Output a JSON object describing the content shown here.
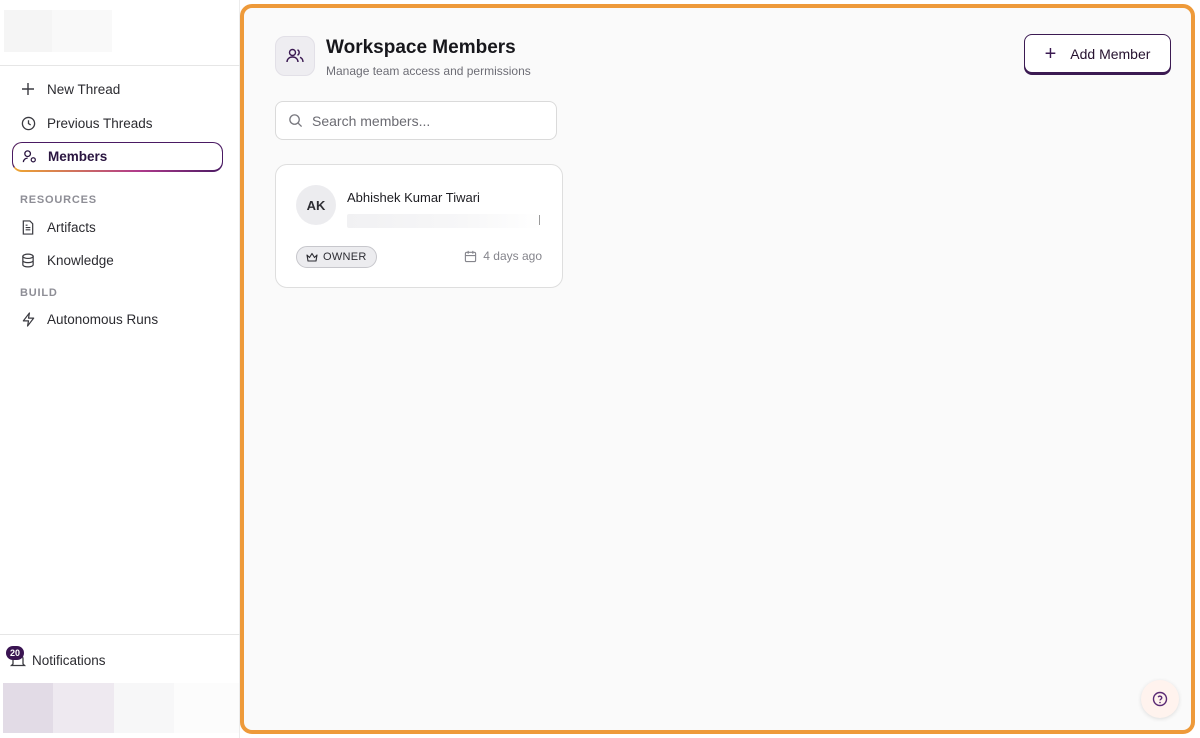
{
  "sidebar": {
    "nav": [
      {
        "label": "New Thread",
        "icon": "plus-icon"
      },
      {
        "label": "Previous Threads",
        "icon": "clock-icon"
      },
      {
        "label": "Members",
        "icon": "user-cog-icon",
        "active": true
      }
    ],
    "resources_label": "RESOURCES",
    "resources": [
      {
        "label": "Artifacts",
        "icon": "file-text-icon"
      },
      {
        "label": "Knowledge",
        "icon": "database-icon"
      }
    ],
    "build_label": "BUILD",
    "build": [
      {
        "label": "Autonomous Runs",
        "icon": "zap-icon"
      }
    ],
    "notifications": {
      "label": "Notifications",
      "count": "20"
    }
  },
  "header": {
    "title": "Workspace Members",
    "subtitle": "Manage team access and permissions",
    "add_button_label": "Add Member"
  },
  "search": {
    "placeholder": "Search members..."
  },
  "members": [
    {
      "initials": "AK",
      "name": "Abhishek Kumar Tiwari",
      "role": "OWNER",
      "joined": "4 days ago"
    }
  ],
  "colors": {
    "accent": "#3b1a52",
    "highlight_border": "#ee9a3a"
  }
}
